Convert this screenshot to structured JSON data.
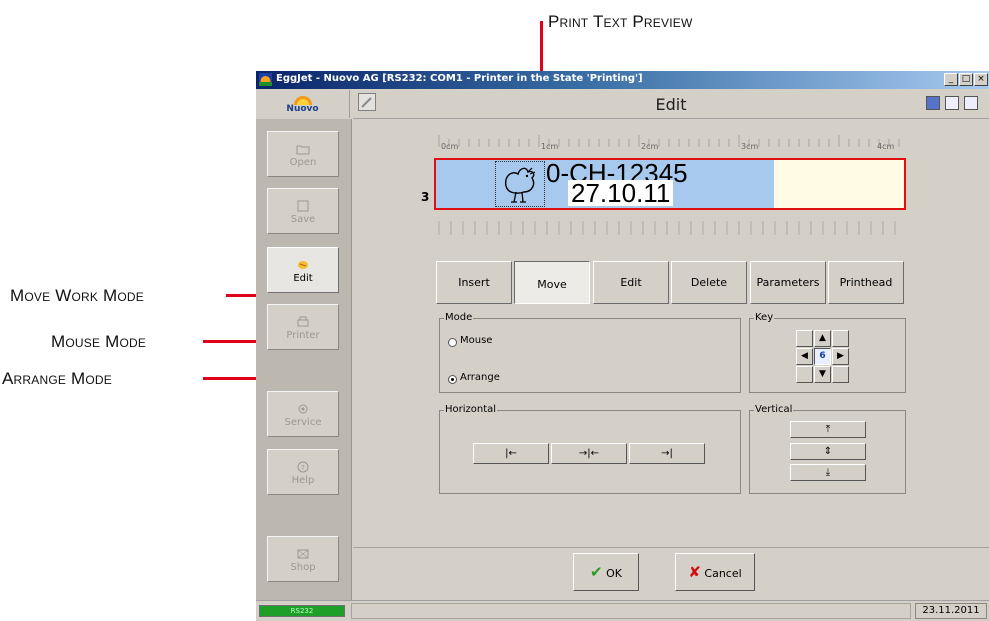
{
  "annotations": {
    "print_text_preview": "Print Text Preview",
    "move_work_mode": "Move Work Mode",
    "mouse_mode": "Mouse Mode",
    "arrange_mode": "Arrange Mode",
    "line_color": "#e0001a"
  },
  "window": {
    "title": "EggJet - Nuovo AG   [RS232: COM1 - Printer in the State 'Printing']",
    "logo_text": "Nuovo",
    "header_title": "Edit",
    "title_buttons": [
      "_",
      "□",
      "×"
    ]
  },
  "sidebar": {
    "items": [
      {
        "label": "Open",
        "icon": "folder-icon",
        "active": false
      },
      {
        "label": "Save",
        "icon": "disk-icon",
        "active": false
      },
      {
        "label": "Edit",
        "icon": "egg-icon",
        "active": true
      },
      {
        "label": "Printer",
        "icon": "printer-icon",
        "active": false
      },
      {
        "label": "Service",
        "icon": "gear-icon",
        "active": false
      },
      {
        "label": "Help",
        "icon": "help-icon",
        "active": false
      },
      {
        "label": "Shop",
        "icon": "shop-icon",
        "active": false
      }
    ]
  },
  "ruler": {
    "labels": [
      "0cm",
      "1cm",
      "2cm",
      "3cm",
      "4cm"
    ]
  },
  "preview": {
    "row_number": "3",
    "line1": "0-CH-12345",
    "line2": "27.10.11",
    "icon": "chicken-icon"
  },
  "tabs": [
    "Insert",
    "Move",
    "Edit",
    "Delete",
    "Parameters",
    "Printhead"
  ],
  "active_tab": "Move",
  "mode": {
    "title": "Mode",
    "options": [
      "Mouse",
      "Arrange"
    ],
    "selected": "Arrange"
  },
  "key": {
    "title": "Key",
    "step_value": "6"
  },
  "horizontal": {
    "title": "Horizontal",
    "buttons": [
      "|←",
      "→|←",
      "→|"
    ]
  },
  "vertical": {
    "title": "Vertical",
    "buttons": [
      "⤒",
      "⇕",
      "⤓"
    ]
  },
  "actions": {
    "ok": "OK",
    "cancel": "Cancel"
  },
  "status": {
    "port": "RS232",
    "date": "23.11.2011"
  }
}
